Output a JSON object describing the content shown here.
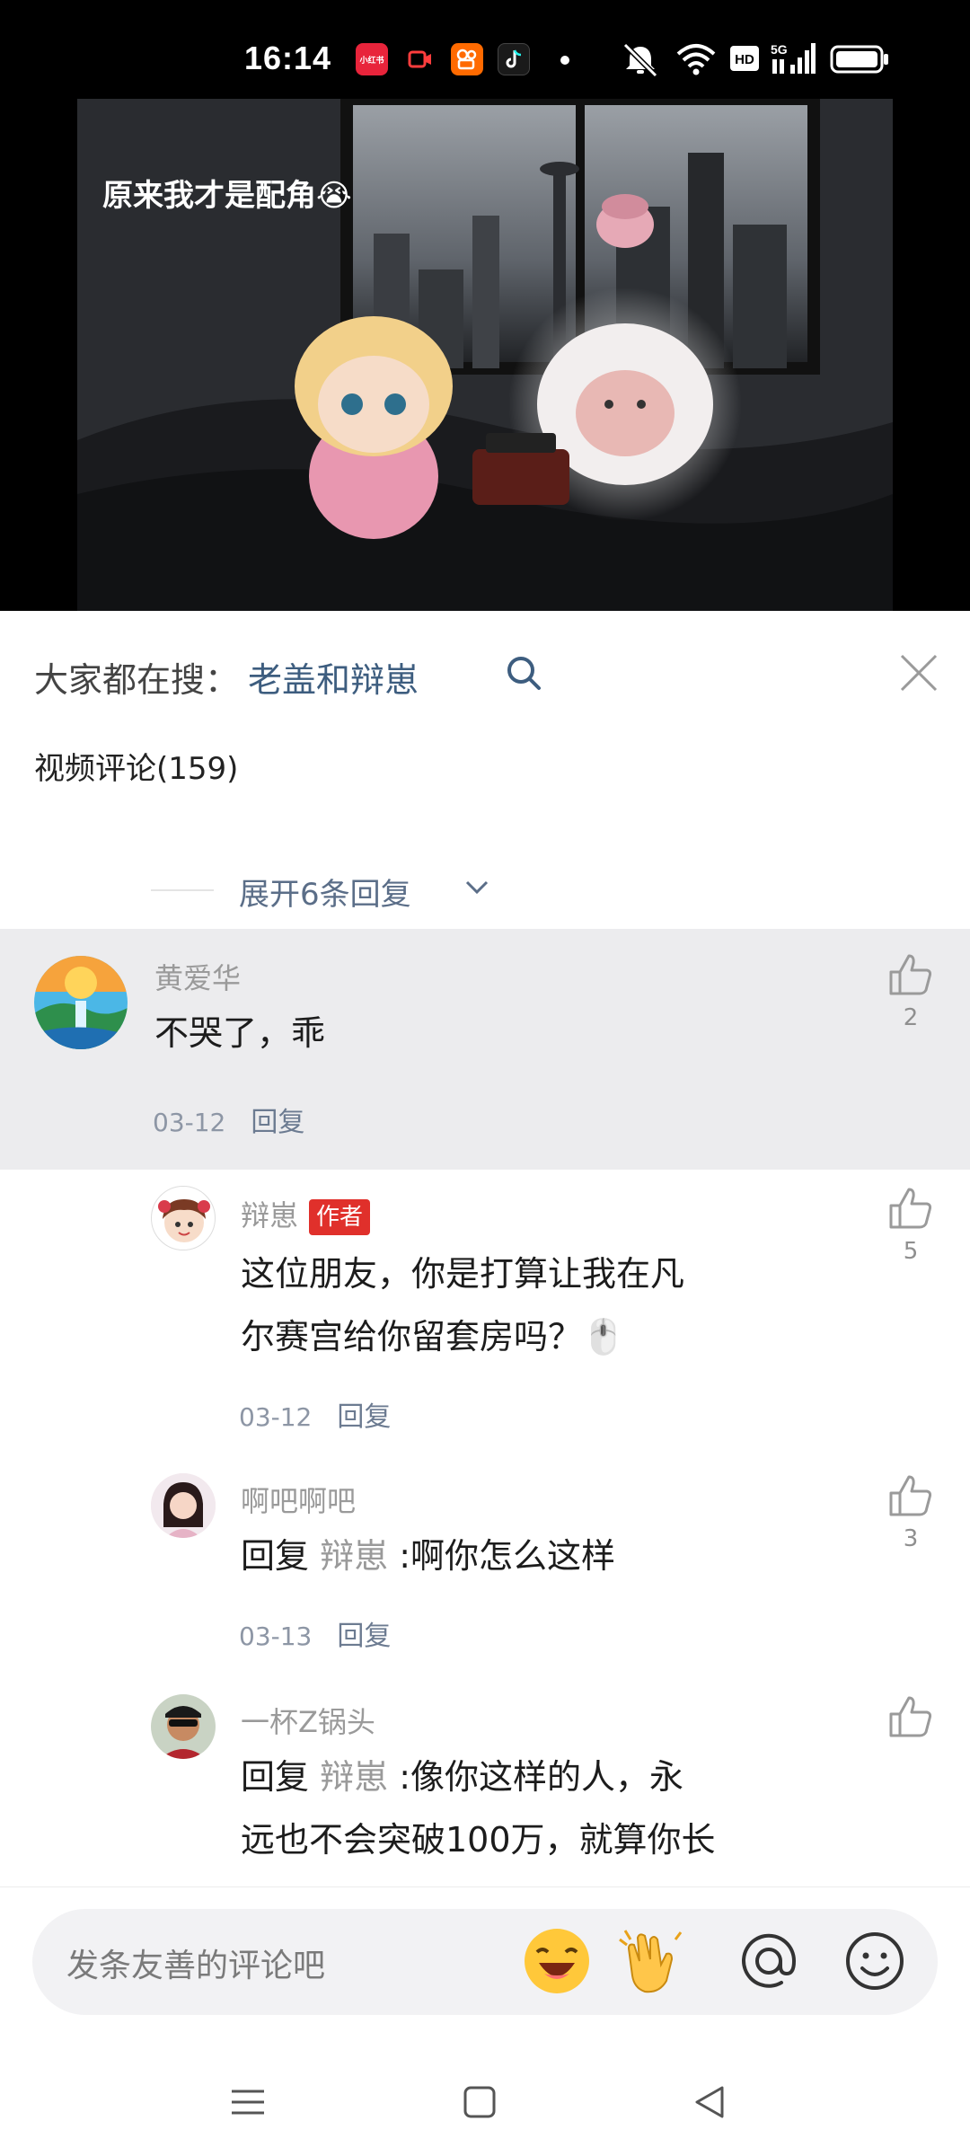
{
  "status_bar": {
    "time": "16:14",
    "apps": [
      "小红书",
      "video-app",
      "kuaishou",
      "tiktok"
    ],
    "indicators": [
      "mute-icon",
      "wifi-icon",
      "hd-icon",
      "5g-signal-icon",
      "battery-icon"
    ],
    "hd_label": "HD",
    "network_label": "5G"
  },
  "video": {
    "caption": "原来我才是配角😭"
  },
  "panel": {
    "search_prefix": "大家都在搜：",
    "search_keyword": "老盖和辩崽",
    "comment_title": "视频评论(159)",
    "expand_label": "展开6条回复"
  },
  "comments": [
    {
      "user": "黄爱华",
      "text": "不哭了，乖",
      "date": "03-12",
      "reply_label": "回复",
      "likes": "2"
    },
    {
      "user": "辩崽",
      "badge": "作者",
      "text_line1": "这位朋友，你是打算让我在凡",
      "text_line2": "尔赛宫给你留套房吗？🖱️",
      "date": "03-12",
      "reply_label": "回复",
      "likes": "5"
    },
    {
      "user": "啊吧啊吧",
      "reply_prefix": "回复",
      "reply_target": "辩崽",
      "text": ":啊你怎么这样",
      "date": "03-13",
      "reply_label": "回复",
      "likes": "3"
    },
    {
      "user": "一杯Z锅头",
      "reply_prefix": "回复",
      "reply_target": "辩崽",
      "text_line1": ":像你这样的人，永",
      "text_line2": "远也不会突破100万，就算你长"
    }
  ],
  "input": {
    "placeholder": "发条友善的评论吧"
  },
  "colors": {
    "accent_blue": "#3d5d7f",
    "author_badge": "#e0302b",
    "highlight_bg": "#ececee"
  }
}
